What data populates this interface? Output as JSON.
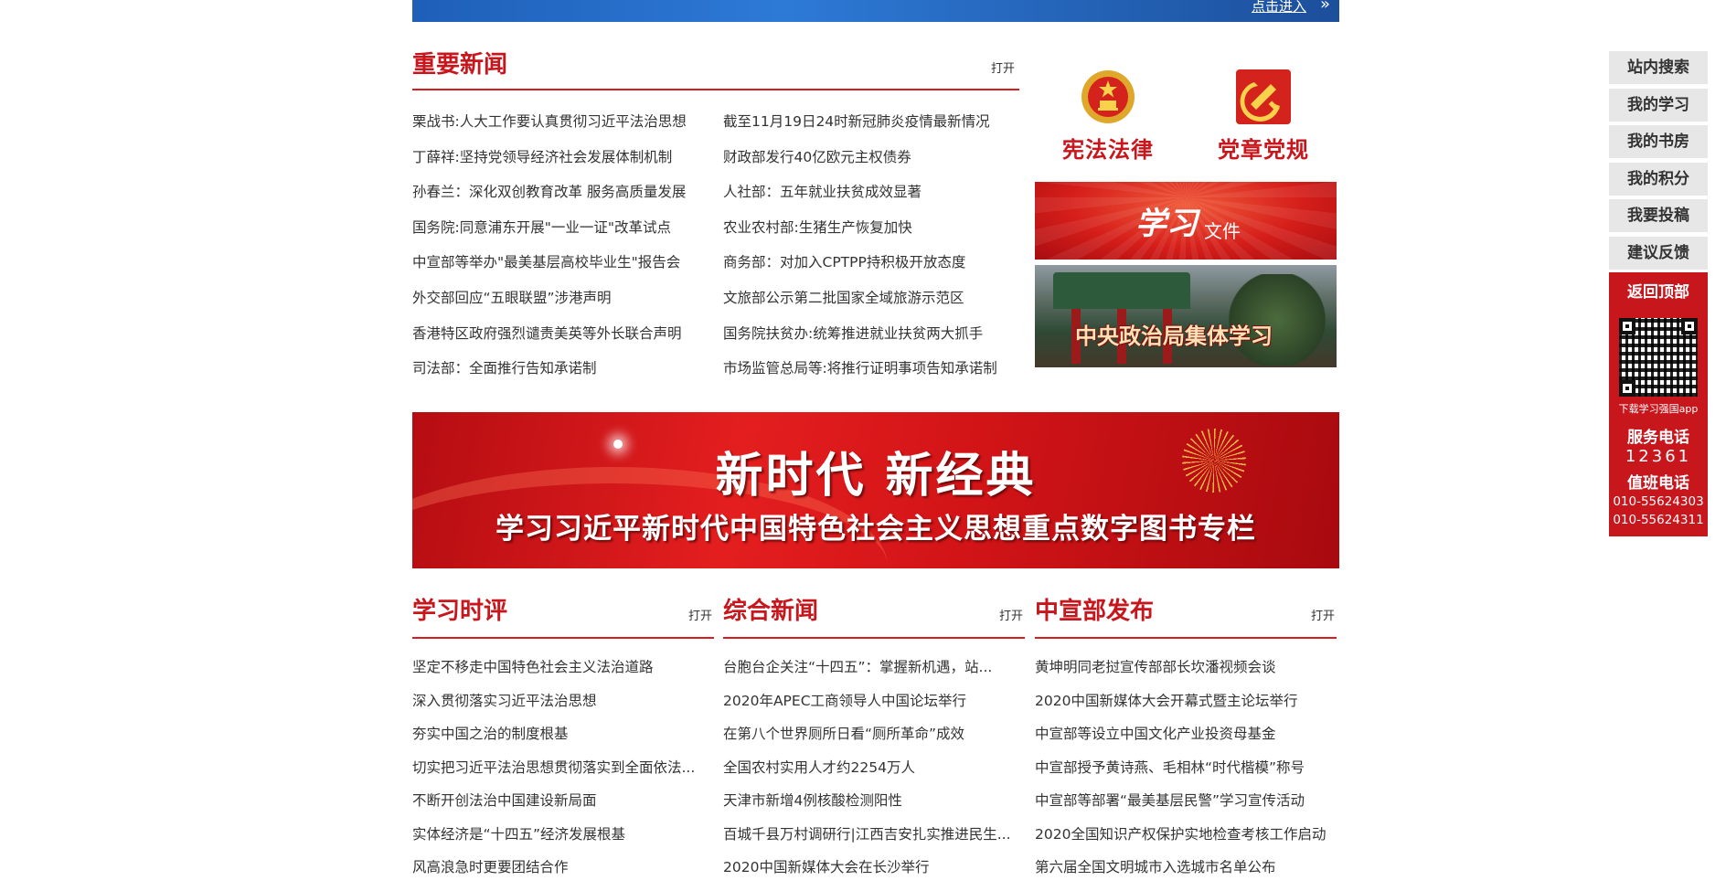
{
  "top_banner": {
    "enter_text": "点击进入",
    "arrow": "»"
  },
  "important_news": {
    "title": "重要新闻",
    "open_label": "打开",
    "left_items": [
      "栗战书:人大工作要认真贯彻习近平法治思想",
      "丁薛祥:坚持党领导经济社会发展体制机制",
      "孙春兰：深化双创教育改革 服务高质量发展",
      "国务院:同意浦东开展\"一业一证\"改革试点",
      "中宣部等举办\"最美基层高校毕业生\"报告会",
      "外交部回应“五眼联盟”涉港声明",
      "香港特区政府强烈谴责美英等外长联合声明",
      "司法部：全面推行告知承诺制"
    ],
    "right_items": [
      "截至11月19日24时新冠肺炎疫情最新情况",
      "财政部发行40亿欧元主权债券",
      "人社部：五年就业扶贫成效显著",
      "农业农村部:生猪生产恢复加快",
      "商务部：对加入CPTPP持积极开放态度",
      "文旅部公示第二批国家全域旅游示范区",
      "国务院扶贫办:统筹推进就业扶贫两大抓手",
      "市场监管总局等:将推行证明事项告知承诺制"
    ]
  },
  "quick_links": {
    "constitution_label": "宪法法律",
    "party_label": "党章党规",
    "xuexi_file_script": "学习",
    "xuexi_file_label": "文件",
    "politburo_label": "中央政治局集体学习"
  },
  "big_banner": {
    "headline": "新时代  新经典",
    "subline": "学习习近平新时代中国特色社会主义思想重点数字图书专栏"
  },
  "columns": [
    {
      "title": "学习时评",
      "open_label": "打开",
      "items": [
        "坚定不移走中国特色社会主义法治道路",
        "深入贯彻落实习近平法治思想",
        "夯实中国之治的制度根基",
        "切实把习近平法治思想贯彻落实到全面依法...",
        "不断开创法治中国建设新局面",
        "实体经济是“十四五”经济发展根基",
        "风高浪急时更要团结合作"
      ]
    },
    {
      "title": "综合新闻",
      "open_label": "打开",
      "items": [
        "台胞台企关注“十四五”：掌握新机遇，站...",
        "2020年APEC工商领导人中国论坛举行",
        "在第八个世界厕所日看“厕所革命”成效",
        "全国农村实用人才约2254万人",
        "天津市新增4例核酸检测阳性",
        "百城千县万村调研行|江西吉安扎实推进民生...",
        "2020中国新媒体大会在长沙举行"
      ]
    },
    {
      "title": "中宣部发布",
      "open_label": "打开",
      "items": [
        "黄坤明同老挝宣传部部长坎潘视频会谈",
        "2020中国新媒体大会开幕式暨主论坛举行",
        "中宣部等设立中国文化产业投资母基金",
        "中宣部授予黄诗燕、毛相林“时代楷模”称号",
        "中宣部等部署“最美基层民警”学习宣传活动",
        "2020全国知识产权保护实地检查考核工作启动",
        "第六届全国文明城市入选城市名单公布"
      ]
    }
  ],
  "float_bar": {
    "buttons": [
      "站内搜索",
      "我的学习",
      "我的书房",
      "我的积分",
      "我要投稿",
      "建议反馈"
    ],
    "back_top": "返回顶部",
    "qr_caption": "下载学习强国app",
    "service_title": "服务电话",
    "service_number": "12361",
    "duty_title": "值班电话",
    "duty_numbers": [
      "010-55624303",
      "010-55624311"
    ]
  },
  "colors": {
    "accent_red": "#c8161d",
    "rule_red": "#d91c22",
    "button_gray": "#e7e7e7"
  }
}
